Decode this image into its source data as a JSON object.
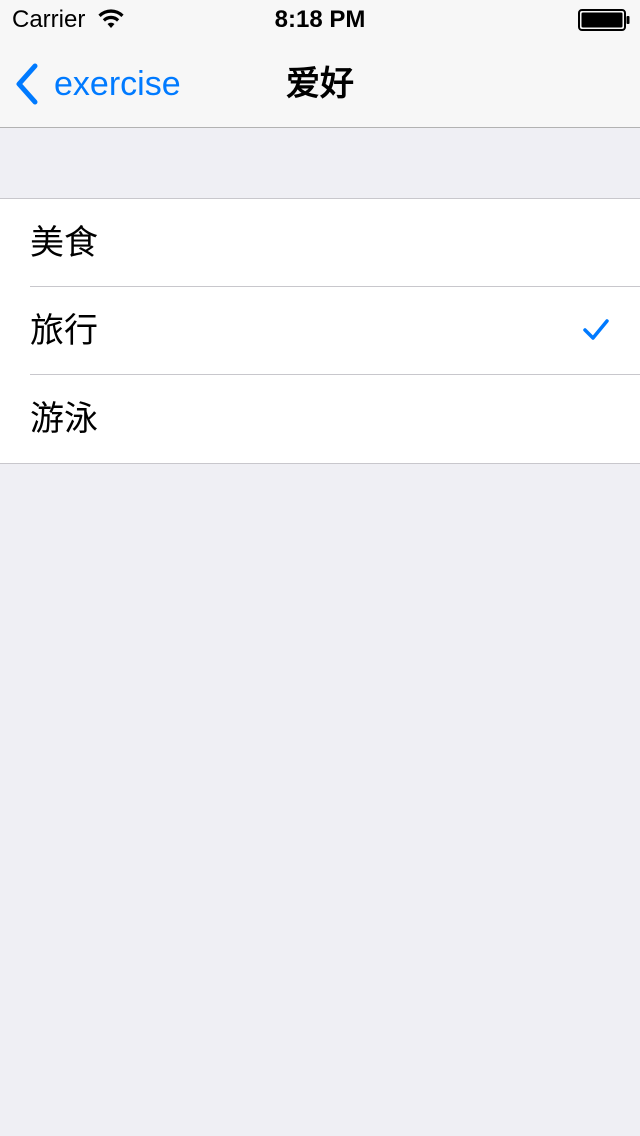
{
  "status_bar": {
    "carrier": "Carrier",
    "time": "8:18 PM"
  },
  "nav_bar": {
    "back_label": "exercise",
    "title": "爱好"
  },
  "list": {
    "items": [
      {
        "label": "美食",
        "checked": false
      },
      {
        "label": "旅行",
        "checked": true
      },
      {
        "label": "游泳",
        "checked": false
      }
    ]
  },
  "colors": {
    "accent": "#007aff",
    "background": "#efeff4",
    "separator": "#c8c7cc"
  },
  "icons": {
    "wifi": "wifi-icon",
    "battery": "battery-icon",
    "back": "chevron-left-icon",
    "check": "checkmark-icon"
  }
}
